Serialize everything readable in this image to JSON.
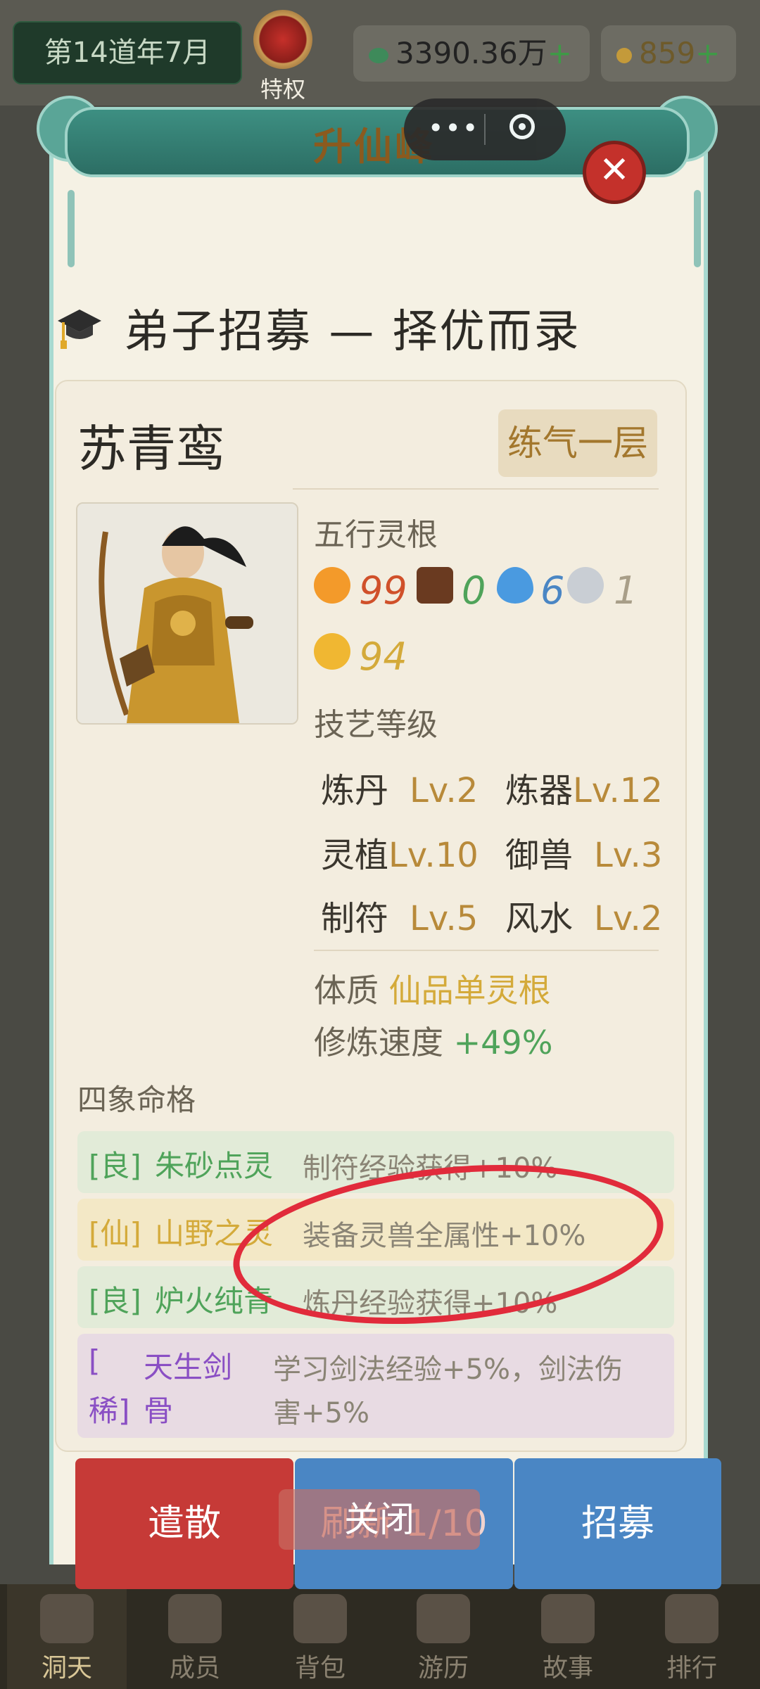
{
  "topbar": {
    "year": "第14道年7月",
    "privilege_label": "特权",
    "jade_amount": "3390.36万",
    "gold_amount": "859",
    "plus": "+"
  },
  "modal": {
    "title": "升仙峰",
    "heading": "弟子招募 — 择优而录"
  },
  "character": {
    "name": "苏青鸾",
    "rank": "练气一层",
    "five_elements_label": "五行灵根",
    "elements": {
      "fire": "99",
      "wood": "0",
      "water": "6",
      "earth": "1",
      "metal": "94"
    },
    "skills_label": "技艺等级",
    "skills": [
      {
        "name": "炼丹",
        "level": "Lv.2"
      },
      {
        "name": "炼器",
        "level": "Lv.12"
      },
      {
        "name": "灵植",
        "level": "Lv.10"
      },
      {
        "name": "御兽",
        "level": "Lv.3"
      },
      {
        "name": "制符",
        "level": "Lv.5"
      },
      {
        "name": "风水",
        "level": "Lv.2"
      }
    ],
    "constitution_label": "体质",
    "constitution_value": "仙品单灵根",
    "speed_label": "修炼速度",
    "speed_value": "+49%"
  },
  "fate": {
    "label": "四象命格",
    "traits": [
      {
        "grade": "[良]",
        "name": "朱砂点灵",
        "desc": "制符经验获得+10%"
      },
      {
        "grade": "[仙]",
        "name": "山野之灵",
        "desc": "装备灵兽全属性+10%"
      },
      {
        "grade": "[良]",
        "name": "炉火纯青",
        "desc": "炼丹经验获得+10%"
      },
      {
        "grade_line1": "[",
        "grade_line2": "稀]",
        "name_line1": "天生剑",
        "name_line2": "骨",
        "desc_line1": "学习剑法经验+5%，剑法伤",
        "desc_line2": "害+5%"
      }
    ]
  },
  "buttons": {
    "dismiss": "遣散",
    "refresh": "刷新 1/10",
    "recruit": "招募",
    "close": "关闭"
  },
  "nav": [
    {
      "label": "洞天"
    },
    {
      "label": "成员"
    },
    {
      "label": "背包"
    },
    {
      "label": "游历"
    },
    {
      "label": "故事"
    },
    {
      "label": "排行"
    }
  ],
  "colors": {
    "fire": "#d0502a",
    "wood": "#4fa35a",
    "water": "#4a86c4",
    "earth": "#a89e88",
    "metal": "#d4aa3a",
    "green_trait_bg": "#e2ebd8",
    "gold_trait_bg": "#f3e8c6",
    "purple_trait_bg": "#e8dbe3",
    "annotation": "#e12b3b"
  }
}
